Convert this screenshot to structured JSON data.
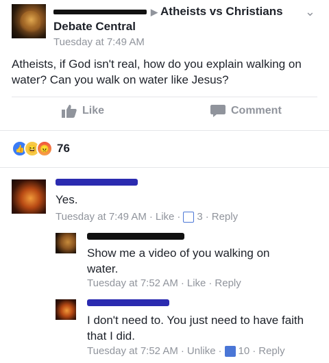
{
  "post": {
    "group_arrow": "▶",
    "group_name": "Atheists vs Christians",
    "group_name_line2": "Debate Central",
    "timestamp": "Tuesday at 7:49 AM",
    "text": "Atheists, if God isn't real, how do you explain walking on water? Can you walk on water like Jesus?",
    "chevron": "⌄"
  },
  "actions": {
    "like_label": "Like",
    "comment_label": "Comment"
  },
  "reactions": {
    "count": "76",
    "types": [
      "like-icon",
      "haha-icon",
      "angry-icon"
    ]
  },
  "comments": [
    {
      "text": "Yes.",
      "time": "Tuesday at 7:49 AM",
      "action": "Like",
      "likes": "3",
      "reply": "Reply"
    },
    {
      "text": "Show me a video of you walking on water.",
      "time": "Tuesday at 7:52 AM",
      "action": "Like",
      "likes": "",
      "reply": "Reply"
    },
    {
      "text": "I don't need to. You just need to have faith that I did.",
      "time": "Tuesday at 7:52 AM",
      "action": "Unlike",
      "likes": "10",
      "reply": "Reply"
    }
  ],
  "colors": {
    "text": "#1d2129",
    "muted": "#90949c",
    "link_blue": "#4267b2",
    "divider": "#e5e6e9"
  }
}
